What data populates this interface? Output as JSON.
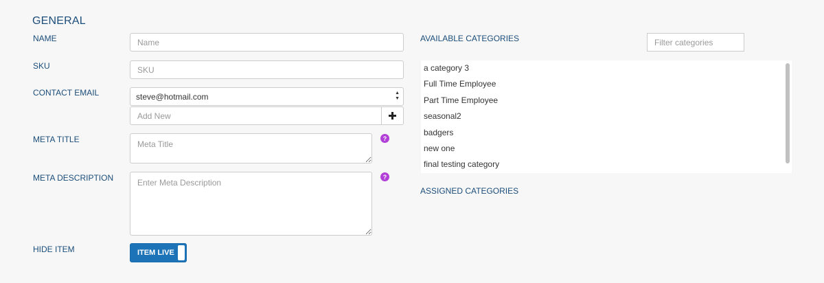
{
  "section": {
    "title": "GENERAL"
  },
  "fields": {
    "name": {
      "label": "NAME",
      "placeholder": "Name",
      "value": ""
    },
    "sku": {
      "label": "SKU",
      "placeholder": "SKU",
      "value": ""
    },
    "contact_email": {
      "label": "CONTACT EMAIL",
      "selected": "steve@hotmail.com",
      "add_new_placeholder": "Add New",
      "add_icon": "plus-icon"
    },
    "meta_title": {
      "label": "META TITLE",
      "placeholder": "Meta Title",
      "help_icon": "question-mark-icon"
    },
    "meta_description": {
      "label": "META DESCRIPTION",
      "placeholder": "Enter Meta Description",
      "help_icon": "question-mark-icon"
    },
    "hide_item": {
      "label": "HIDE ITEM",
      "toggle_label": "ITEM LIVE"
    }
  },
  "categories": {
    "available_title": "AVAILABLE CATEGORIES",
    "filter_placeholder": "Filter categories",
    "items": [
      "a category 3",
      "Full Time Employee",
      "Part Time Employee",
      "seasonal2",
      "badgers",
      "new one",
      "final testing category"
    ],
    "assigned_title": "ASSIGNED CATEGORIES"
  },
  "colors": {
    "accent": "#1c73b8",
    "label": "#1b4d7a",
    "help_icon": "#b23fd6",
    "background": "#f7f7f7"
  }
}
